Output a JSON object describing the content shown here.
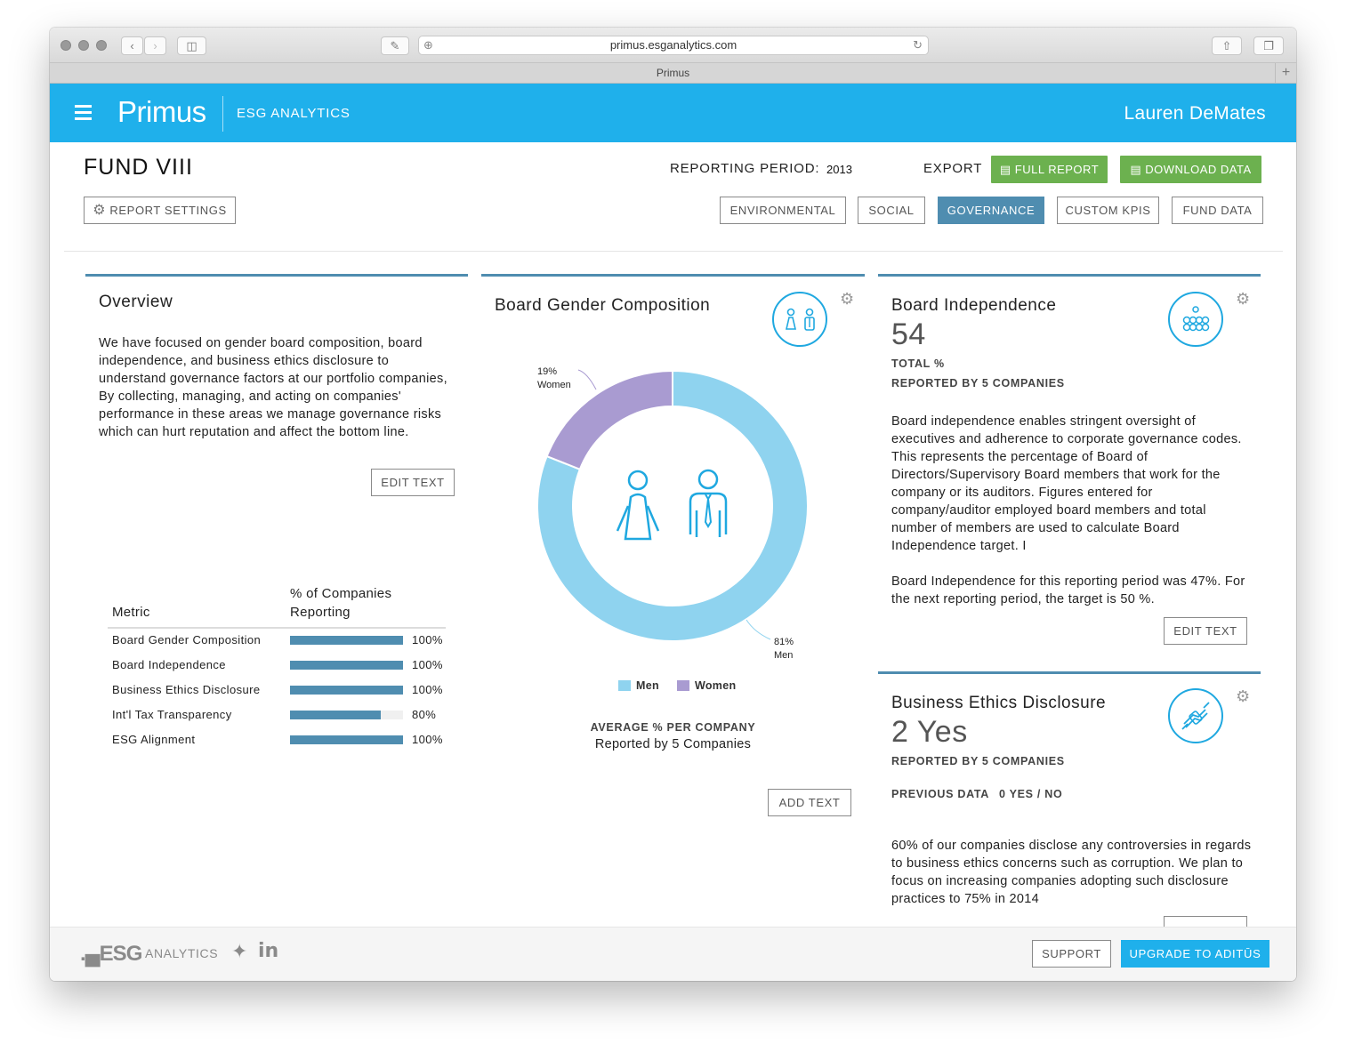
{
  "browser": {
    "url": "primus.esganalytics.com",
    "tab_title": "Primus"
  },
  "header": {
    "brand": "Primus",
    "subtitle": "ESG ANALYTICS",
    "user": "Lauren DeMates"
  },
  "page": {
    "fund_title": "FUND VIII",
    "reporting_period_label": "REPORTING PERIOD:",
    "reporting_period_value": "2013",
    "export_label": "EXPORT",
    "full_report": "FULL REPORT",
    "download_data": "DOWNLOAD DATA",
    "report_settings": "REPORT SETTINGS",
    "tabs": [
      "ENVIRONMENTAL",
      "SOCIAL",
      "GOVERNANCE",
      "CUSTOM KPIS",
      "FUND DATA"
    ],
    "active_tab": "GOVERNANCE"
  },
  "overview": {
    "title": "Overview",
    "text": "We have focused on gender board composition, board independence, and business ethics disclosure to understand governance factors at our portfolio companies, By collecting, managing, and acting on companies' performance in these areas we manage governance risks which can hurt reputation and affect the bottom line.",
    "edit_button": "EDIT TEXT",
    "col_metric": "Metric",
    "col_pct": "% of Companies Reporting",
    "metrics": [
      {
        "name": "Board Gender Composition",
        "pct_label": "100%",
        "pct": 100
      },
      {
        "name": "Board Independence",
        "pct_label": "100%",
        "pct": 100
      },
      {
        "name": "Business Ethics Disclosure",
        "pct_label": "100%",
        "pct": 100
      },
      {
        "name": "Int'l Tax Transparency",
        "pct_label": "80%",
        "pct": 80
      },
      {
        "name": "ESG Alignment",
        "pct_label": "100%",
        "pct": 100
      }
    ]
  },
  "gender": {
    "title": "Board Gender Composition",
    "women_pct": "19%",
    "women_label": "Women",
    "men_pct": "81%",
    "men_label": "Men",
    "legend_men": "Men",
    "legend_women": "Women",
    "avg_label": "AVERAGE % PER COMPANY",
    "reported_by": "Reported by 5 Companies",
    "add_button": "ADD TEXT",
    "colors": {
      "men": "#8fd3ef",
      "women": "#a99bd1"
    }
  },
  "chart_data": {
    "type": "pie",
    "categories": [
      "Men",
      "Women"
    ],
    "values": [
      81,
      19
    ],
    "title": "Board Gender Composition",
    "legend": "bottom"
  },
  "independence": {
    "title": "Board Independence",
    "value": "54",
    "unit": "TOTAL %",
    "reported_by": "REPORTED BY 5 COMPANIES",
    "text1": "Board independence enables stringent oversight of executives and adherence to corporate governance codes. This represents the percentage of Board of Directors/Supervisory Board members that work for the company or its auditors. Figures entered for company/auditor employed board members and total number of members are used to calculate Board Independence target. I",
    "text2": "Board Independence for this reporting period was 47%. For the next reporting period, the target is 50 %.",
    "edit_button": "EDIT TEXT"
  },
  "ethics": {
    "title": "Business Ethics Disclosure",
    "value": "2 Yes",
    "reported_by": "REPORTED BY 5 COMPANIES",
    "previous_label": "PREVIOUS DATA",
    "previous_value": "0 YES / NO",
    "text": "60% of our companies disclose any controversies in regards to business ethics concerns such as corruption. We plan to focus on increasing companies adopting such disclosure practices to 75% in 2014"
  },
  "footer": {
    "logo": ".▄ESG",
    "logo_sub": "ANALYTICS",
    "support": "SUPPORT",
    "upgrade": "UPGRADE TO ADITŪS"
  }
}
